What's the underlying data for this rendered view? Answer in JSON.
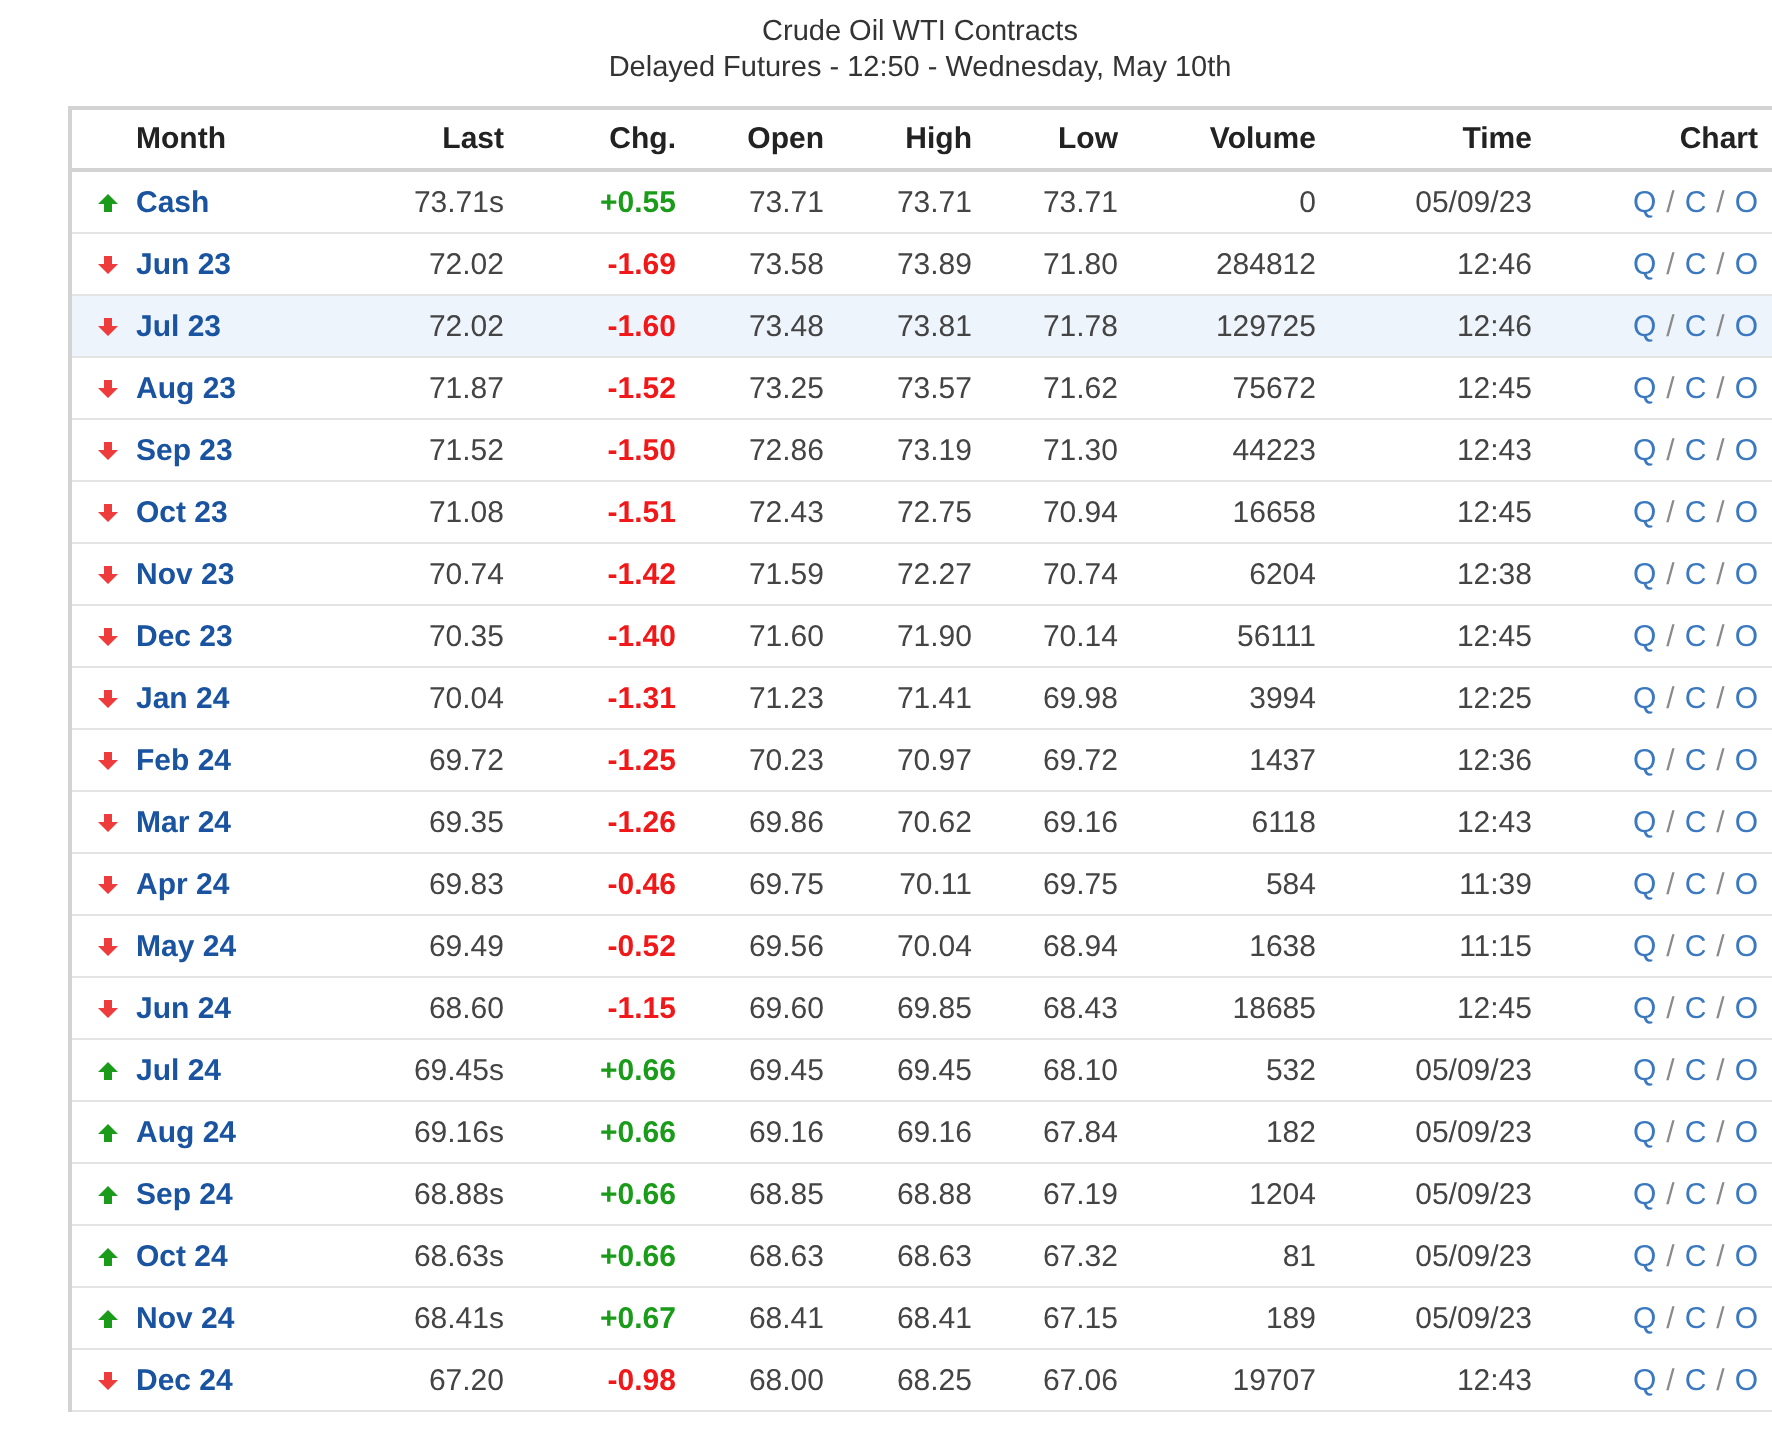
{
  "title": "Crude Oil WTI Contracts",
  "subtitle": "Delayed Futures - 12:50 - Wednesday, May 10th",
  "table": {
    "columns": [
      "Month",
      "Last",
      "Chg.",
      "Open",
      "High",
      "Low",
      "Volume",
      "Time",
      "Chart"
    ],
    "link_separator": "/",
    "rows": [
      {
        "rising": true,
        "selected": false,
        "month": "Cash",
        "last": "73.71s",
        "chg": "+0.55",
        "open": "73.71",
        "high": "73.71",
        "low": "73.71",
        "volume": "0",
        "time": "05/09/23",
        "chart": [
          "Q",
          "C",
          "O"
        ]
      },
      {
        "rising": false,
        "selected": false,
        "month": "Jun 23",
        "last": "72.02",
        "chg": "-1.69",
        "open": "73.58",
        "high": "73.89",
        "low": "71.80",
        "volume": "284812",
        "time": "12:46",
        "chart": [
          "Q",
          "C",
          "O"
        ]
      },
      {
        "rising": false,
        "selected": true,
        "month": "Jul 23",
        "last": "72.02",
        "chg": "-1.60",
        "open": "73.48",
        "high": "73.81",
        "low": "71.78",
        "volume": "129725",
        "time": "12:46",
        "chart": [
          "Q",
          "C",
          "O"
        ]
      },
      {
        "rising": false,
        "selected": false,
        "month": "Aug 23",
        "last": "71.87",
        "chg": "-1.52",
        "open": "73.25",
        "high": "73.57",
        "low": "71.62",
        "volume": "75672",
        "time": "12:45",
        "chart": [
          "Q",
          "C",
          "O"
        ]
      },
      {
        "rising": false,
        "selected": false,
        "month": "Sep 23",
        "last": "71.52",
        "chg": "-1.50",
        "open": "72.86",
        "high": "73.19",
        "low": "71.30",
        "volume": "44223",
        "time": "12:43",
        "chart": [
          "Q",
          "C",
          "O"
        ]
      },
      {
        "rising": false,
        "selected": false,
        "month": "Oct 23",
        "last": "71.08",
        "chg": "-1.51",
        "open": "72.43",
        "high": "72.75",
        "low": "70.94",
        "volume": "16658",
        "time": "12:45",
        "chart": [
          "Q",
          "C",
          "O"
        ]
      },
      {
        "rising": false,
        "selected": false,
        "month": "Nov 23",
        "last": "70.74",
        "chg": "-1.42",
        "open": "71.59",
        "high": "72.27",
        "low": "70.74",
        "volume": "6204",
        "time": "12:38",
        "chart": [
          "Q",
          "C",
          "O"
        ]
      },
      {
        "rising": false,
        "selected": false,
        "month": "Dec 23",
        "last": "70.35",
        "chg": "-1.40",
        "open": "71.60",
        "high": "71.90",
        "low": "70.14",
        "volume": "56111",
        "time": "12:45",
        "chart": [
          "Q",
          "C",
          "O"
        ]
      },
      {
        "rising": false,
        "selected": false,
        "month": "Jan 24",
        "last": "70.04",
        "chg": "-1.31",
        "open": "71.23",
        "high": "71.41",
        "low": "69.98",
        "volume": "3994",
        "time": "12:25",
        "chart": [
          "Q",
          "C",
          "O"
        ]
      },
      {
        "rising": false,
        "selected": false,
        "month": "Feb 24",
        "last": "69.72",
        "chg": "-1.25",
        "open": "70.23",
        "high": "70.97",
        "low": "69.72",
        "volume": "1437",
        "time": "12:36",
        "chart": [
          "Q",
          "C",
          "O"
        ]
      },
      {
        "rising": false,
        "selected": false,
        "month": "Mar 24",
        "last": "69.35",
        "chg": "-1.26",
        "open": "69.86",
        "high": "70.62",
        "low": "69.16",
        "volume": "6118",
        "time": "12:43",
        "chart": [
          "Q",
          "C",
          "O"
        ]
      },
      {
        "rising": false,
        "selected": false,
        "month": "Apr 24",
        "last": "69.83",
        "chg": "-0.46",
        "open": "69.75",
        "high": "70.11",
        "low": "69.75",
        "volume": "584",
        "time": "11:39",
        "chart": [
          "Q",
          "C",
          "O"
        ]
      },
      {
        "rising": false,
        "selected": false,
        "month": "May 24",
        "last": "69.49",
        "chg": "-0.52",
        "open": "69.56",
        "high": "70.04",
        "low": "68.94",
        "volume": "1638",
        "time": "11:15",
        "chart": [
          "Q",
          "C",
          "O"
        ]
      },
      {
        "rising": false,
        "selected": false,
        "month": "Jun 24",
        "last": "68.60",
        "chg": "-1.15",
        "open": "69.60",
        "high": "69.85",
        "low": "68.43",
        "volume": "18685",
        "time": "12:45",
        "chart": [
          "Q",
          "C",
          "O"
        ]
      },
      {
        "rising": true,
        "selected": false,
        "month": "Jul 24",
        "last": "69.45s",
        "chg": "+0.66",
        "open": "69.45",
        "high": "69.45",
        "low": "68.10",
        "volume": "532",
        "time": "05/09/23",
        "chart": [
          "Q",
          "C",
          "O"
        ]
      },
      {
        "rising": true,
        "selected": false,
        "month": "Aug 24",
        "last": "69.16s",
        "chg": "+0.66",
        "open": "69.16",
        "high": "69.16",
        "low": "67.84",
        "volume": "182",
        "time": "05/09/23",
        "chart": [
          "Q",
          "C",
          "O"
        ]
      },
      {
        "rising": true,
        "selected": false,
        "month": "Sep 24",
        "last": "68.88s",
        "chg": "+0.66",
        "open": "68.85",
        "high": "68.88",
        "low": "67.19",
        "volume": "1204",
        "time": "05/09/23",
        "chart": [
          "Q",
          "C",
          "O"
        ]
      },
      {
        "rising": true,
        "selected": false,
        "month": "Oct 24",
        "last": "68.63s",
        "chg": "+0.66",
        "open": "68.63",
        "high": "68.63",
        "low": "67.32",
        "volume": "81",
        "time": "05/09/23",
        "chart": [
          "Q",
          "C",
          "O"
        ]
      },
      {
        "rising": true,
        "selected": false,
        "month": "Nov 24",
        "last": "68.41s",
        "chg": "+0.67",
        "open": "68.41",
        "high": "68.41",
        "low": "67.15",
        "volume": "189",
        "time": "05/09/23",
        "chart": [
          "Q",
          "C",
          "O"
        ]
      },
      {
        "rising": false,
        "selected": false,
        "month": "Dec 24",
        "last": "67.20",
        "chg": "-0.98",
        "open": "68.00",
        "high": "68.25",
        "low": "67.06",
        "volume": "19707",
        "time": "12:43",
        "chart": [
          "Q",
          "C",
          "O"
        ]
      }
    ]
  }
}
